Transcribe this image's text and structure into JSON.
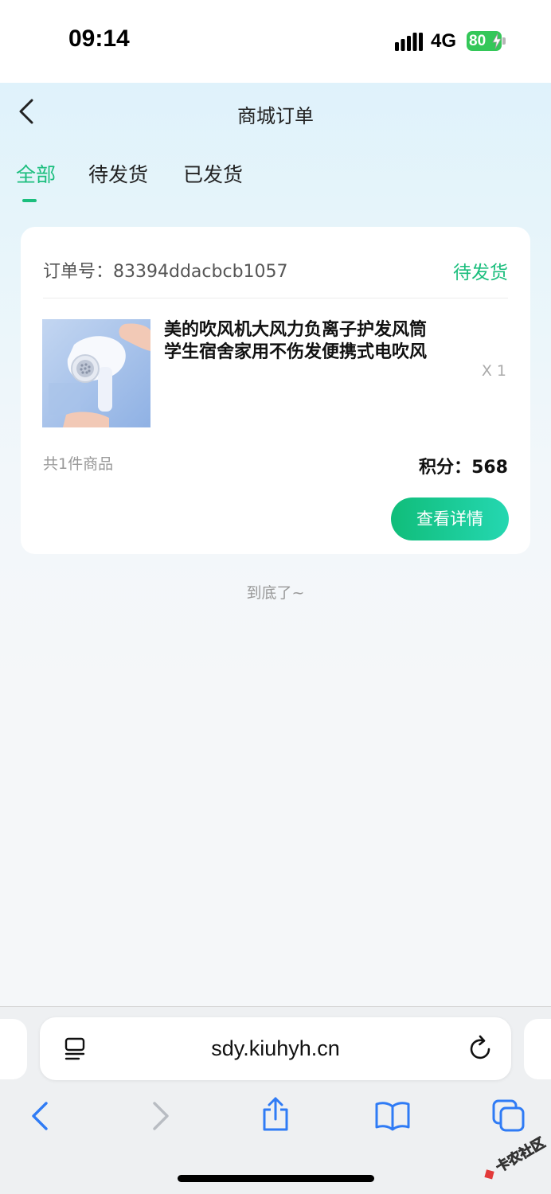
{
  "status_bar": {
    "time": "09:14",
    "network": "4G",
    "battery": "80"
  },
  "header": {
    "title": "商城订单"
  },
  "tabs": [
    {
      "label": "全部",
      "active": true
    },
    {
      "label": "待发货",
      "active": false
    },
    {
      "label": "已发货",
      "active": false
    }
  ],
  "order": {
    "order_no_label": "订单号：",
    "order_no": "83394ddacbcb1057",
    "status": "待发货",
    "product_name": "美的吹风机大风力负离子护发风筒学生宿舍家用不伤发便携式电吹风",
    "quantity": "X 1",
    "item_count": "共1件商品",
    "points_label": "积分：",
    "points_value": "568",
    "detail_button": "查看详情"
  },
  "list_end_text": "到底了~",
  "browser": {
    "url": "sdy.kiuhyh.cn"
  },
  "watermark_text": "卡农社区",
  "colors": {
    "accent": "#1bbe7d",
    "ios_blue": "#2f7bf5",
    "battery_green": "#34c759"
  }
}
